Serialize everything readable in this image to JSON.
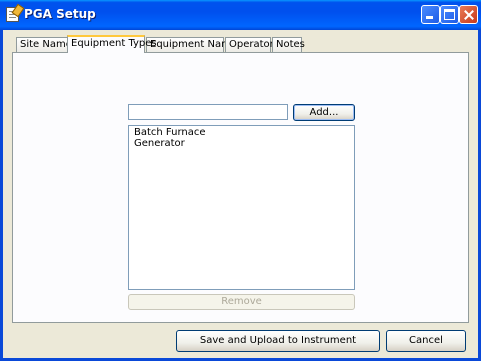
{
  "window": {
    "title": "PGA Setup"
  },
  "tabs": [
    {
      "label": "Site Names"
    },
    {
      "label": "Equipment Types"
    },
    {
      "label": "Equipment Names"
    },
    {
      "label": "Operators"
    },
    {
      "label": "Notes"
    }
  ],
  "active_tab": "Equipment Types",
  "equipment_types": {
    "input_value": "",
    "add_label": "Add...",
    "items": [
      "Batch Furnace",
      "Generator"
    ],
    "remove_label": "Remove"
  },
  "footer": {
    "save_label": "Save and Upload to Instrument",
    "cancel_label": "Cancel"
  }
}
